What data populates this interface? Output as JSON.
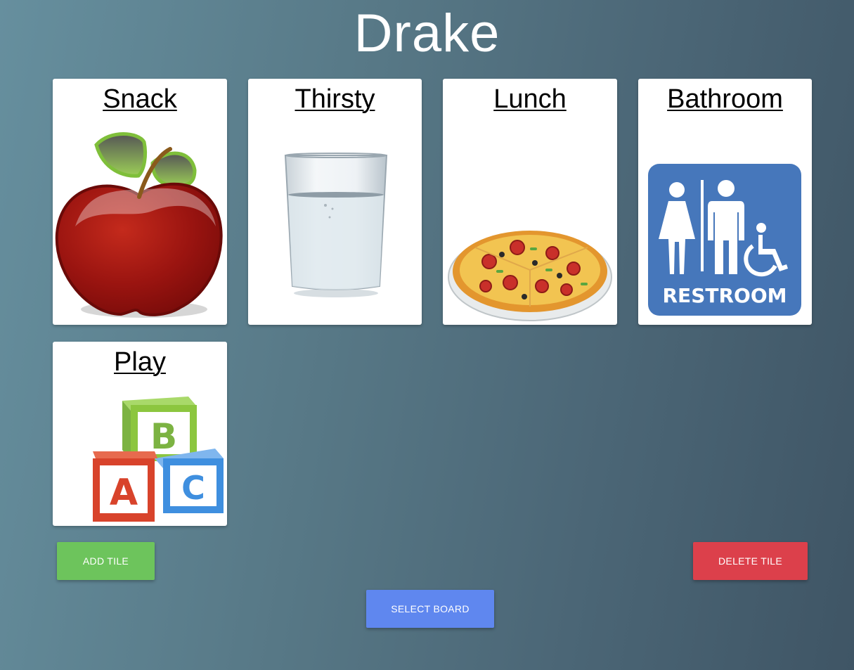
{
  "board": {
    "title": "Drake"
  },
  "tiles": [
    {
      "label": "Snack",
      "icon": "apple-icon"
    },
    {
      "label": "Thirsty",
      "icon": "water-glass-icon"
    },
    {
      "label": "Lunch",
      "icon": "pizza-icon"
    },
    {
      "label": "Bathroom",
      "icon": "restroom-sign-icon",
      "sign_text": "RESTROOM"
    },
    {
      "label": "Play",
      "icon": "abc-blocks-icon",
      "block_letters": [
        "B",
        "A",
        "C"
      ]
    }
  ],
  "actions": {
    "add_label": "ADD TILE",
    "delete_label": "DELETE TILE",
    "select_label": "SELECT BOARD"
  },
  "colors": {
    "add": "#6dc45c",
    "delete": "#dc404b",
    "select": "#5f87ef",
    "restroom_sign": "#4677bb"
  }
}
